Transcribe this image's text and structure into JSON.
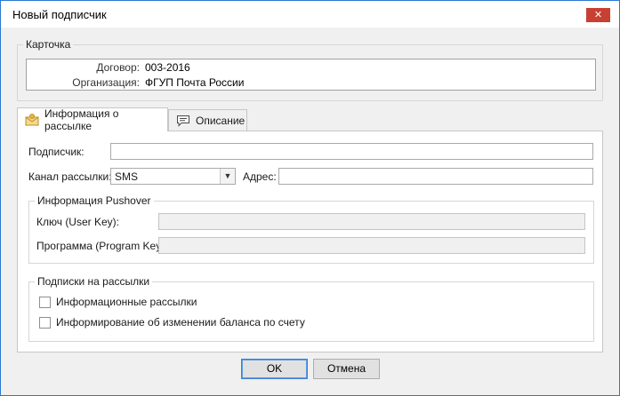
{
  "window": {
    "title": "Новый подписчик",
    "close_glyph": "✕"
  },
  "card": {
    "legend": "Карточка",
    "contract_label": "Договор:",
    "contract_value": "003-2016",
    "org_label": "Организация:",
    "org_value": "ФГУП Почта России"
  },
  "tabs": [
    {
      "label": "Информация о рассылке",
      "icon": "mail-envelope-icon",
      "active": true
    },
    {
      "label": "Описание",
      "icon": "comment-icon",
      "active": false
    }
  ],
  "form": {
    "subscriber_label": "Подписчик:",
    "subscriber_value": "",
    "channel_label": "Канал рассылки:",
    "channel_value": "SMS",
    "address_label": "Адрес:",
    "address_value": ""
  },
  "pushover": {
    "legend": "Информация Pushover",
    "user_key_label": "Ключ (User Key):",
    "user_key_value": "",
    "program_key_label": "Программа (Program Key):",
    "program_key_value": ""
  },
  "subscriptions": {
    "legend": "Подписки на рассылки",
    "items": [
      {
        "label": "Информационные рассылки",
        "checked": false
      },
      {
        "label": "Информирование об изменении баланса по счету",
        "checked": false
      }
    ]
  },
  "buttons": {
    "ok": "OK",
    "cancel": "Отмена"
  },
  "colors": {
    "window_border": "#2b79d3",
    "close_button": "#c84031",
    "background": "#f0f0f0"
  }
}
